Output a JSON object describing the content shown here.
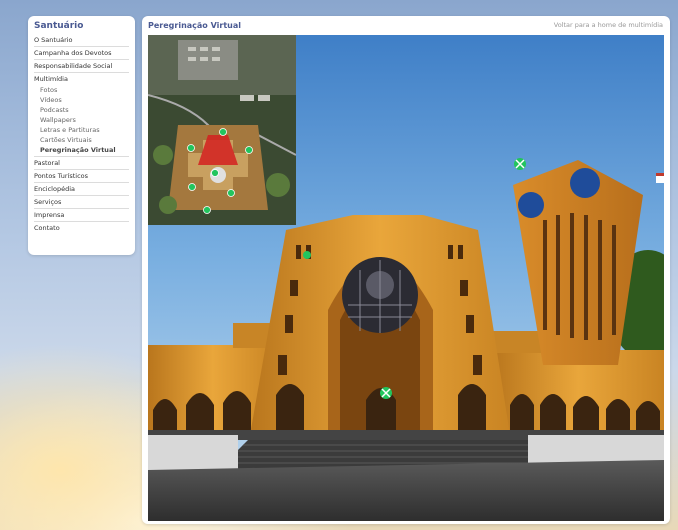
{
  "sidebar": {
    "title": "Santuário",
    "items": [
      {
        "label": "O Santuário"
      },
      {
        "label": "Campanha dos Devotos"
      },
      {
        "label": "Responsabilidade Social"
      }
    ],
    "multimidia": {
      "label": "Multimídia",
      "subitems": [
        "Fotos",
        "Vídeos",
        "Podcasts",
        "Wallpapers",
        "Letras e Partituras",
        "Cartões Virtuais",
        "Peregrinação Virtual"
      ],
      "active": "Peregrinação Virtual"
    },
    "items_after": [
      {
        "label": "Pastoral"
      },
      {
        "label": "Pontos Turísticos"
      },
      {
        "label": "Enciclopédia"
      },
      {
        "label": "Serviços"
      },
      {
        "label": "Imprensa"
      },
      {
        "label": "Contato"
      }
    ]
  },
  "main": {
    "title": "Peregrinação Virtual",
    "back_link": "Voltar para a home de multimídia"
  },
  "colors": {
    "accent": "#4a5a92",
    "hotspot": "#22c55e"
  },
  "icons": [
    "map-hotspot-icon",
    "navigation-hotspot-icon",
    "clock-icon",
    "flag-icon"
  ]
}
